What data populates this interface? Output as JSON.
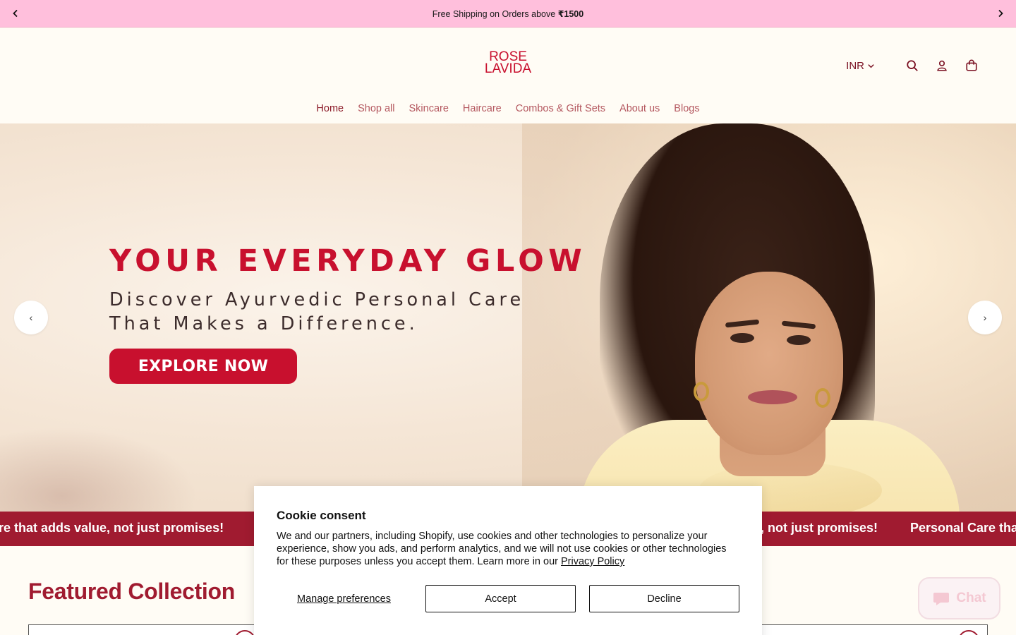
{
  "announcement": {
    "text_prefix": "Free Shipping on Orders above ",
    "text_amount": "₹1500",
    "prev_icon": "chevron-left-icon",
    "next_icon": "chevron-right-icon"
  },
  "header": {
    "logo_line1": "ROSE",
    "logo_line2": "LAVIDA",
    "currency": "INR",
    "icons": [
      "search-icon",
      "account-icon",
      "cart-icon"
    ]
  },
  "nav": {
    "items": [
      {
        "label": "Home",
        "active": true
      },
      {
        "label": "Shop all"
      },
      {
        "label": "Skincare"
      },
      {
        "label": "Haircare"
      },
      {
        "label": "Combos & Gift Sets"
      },
      {
        "label": "About us"
      },
      {
        "label": "Blogs"
      }
    ]
  },
  "hero": {
    "title": "YOUR EVERYDAY GLOW",
    "subtitle_line1": "Discover Ayurvedic Personal Care",
    "subtitle_line2": "That Makes a Difference.",
    "cta": "EXPLORE NOW",
    "prev_arrow": "‹",
    "next_arrow": "›"
  },
  "marquee": {
    "item1": "re that adds value, not just promises!",
    "item2": ", not just promises!",
    "item3": "Personal Care tha"
  },
  "featured": {
    "title": "Featured Collection"
  },
  "chat": {
    "label": "Chat"
  },
  "cookie": {
    "title": "Cookie consent",
    "body": "We and our partners, including Shopify, use cookies and other technologies to personalize your experience, show you ads, and perform analytics, and we will not use cookies or other technologies for these purposes unless you accept them. Learn more in our ",
    "privacy_link": "Privacy Policy",
    "manage": "Manage preferences",
    "accept": "Accept",
    "decline": "Decline"
  },
  "colors": {
    "brand_red": "#c8102e",
    "marquee_bg": "#a01b30",
    "announce_bg": "#ffbfdc"
  }
}
